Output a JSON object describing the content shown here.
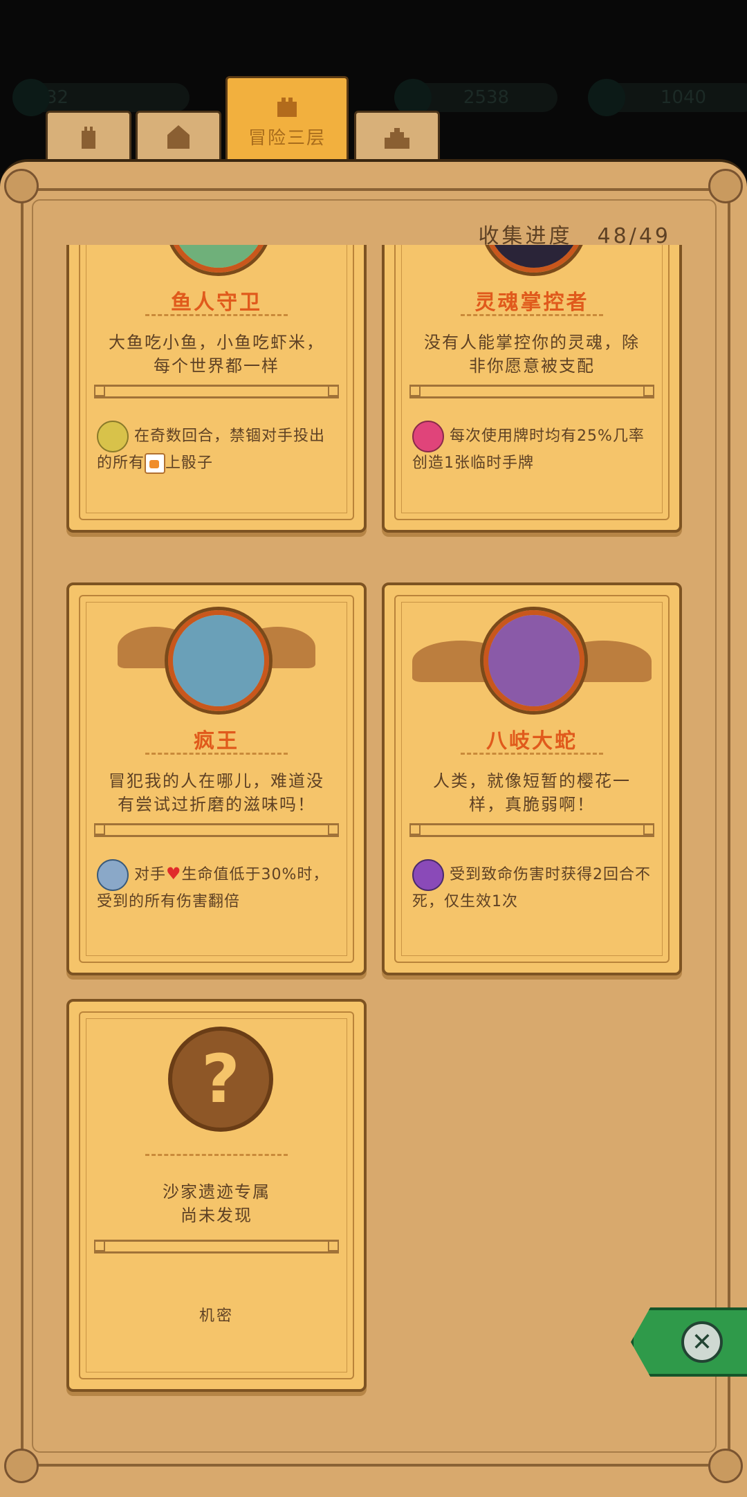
{
  "hud": {
    "level": "32",
    "gems": "2538",
    "coins": "1040"
  },
  "tabs": [
    {
      "name": "tower-1"
    },
    {
      "name": "tower-2"
    },
    {
      "name": "active",
      "label": "冒险三层"
    },
    {
      "name": "tower-4"
    }
  ],
  "collection": {
    "label": "收集进度",
    "value": "48/49"
  },
  "cards": [
    {
      "name": "鱼人守卫",
      "quote": "大鱼吃小鱼，小鱼吃虾米，每个世界都一样",
      "ability_a": "在奇数回合，禁锢对手投出的所有",
      "ability_b": "上骰子",
      "portrait_color": "#6fb07a",
      "icon_color": "#d8c24a"
    },
    {
      "name": "灵魂掌控者",
      "quote": "没有人能掌控你的灵魂，除非你愿意被支配",
      "ability": "每次使用牌时均有25%几率创造1张临时手牌",
      "portrait_color": "#2a2438",
      "icon_color": "#e0447a"
    },
    {
      "name": "疯王",
      "quote": "冒犯我的人在哪儿，难道没有尝试过折磨的滋味吗！",
      "ability_a": "对手",
      "ability_b": "生命值低于30%时，受到的所有伤害翻倍",
      "portrait_color": "#6aa0b8",
      "icon_color": "#8aa8c8"
    },
    {
      "name": "八岐大蛇",
      "quote": "人类，就像短暂的樱花一样，真脆弱啊！",
      "ability": "受到致命伤害时获得2回合不死，仅生效1次",
      "portrait_color": "#8a5aa8",
      "icon_color": "#8a4ab8"
    },
    {
      "name": "沙家遗迹专属",
      "status": "尚未发现",
      "secret": "机密",
      "locked": true
    }
  ],
  "close_label": "close"
}
